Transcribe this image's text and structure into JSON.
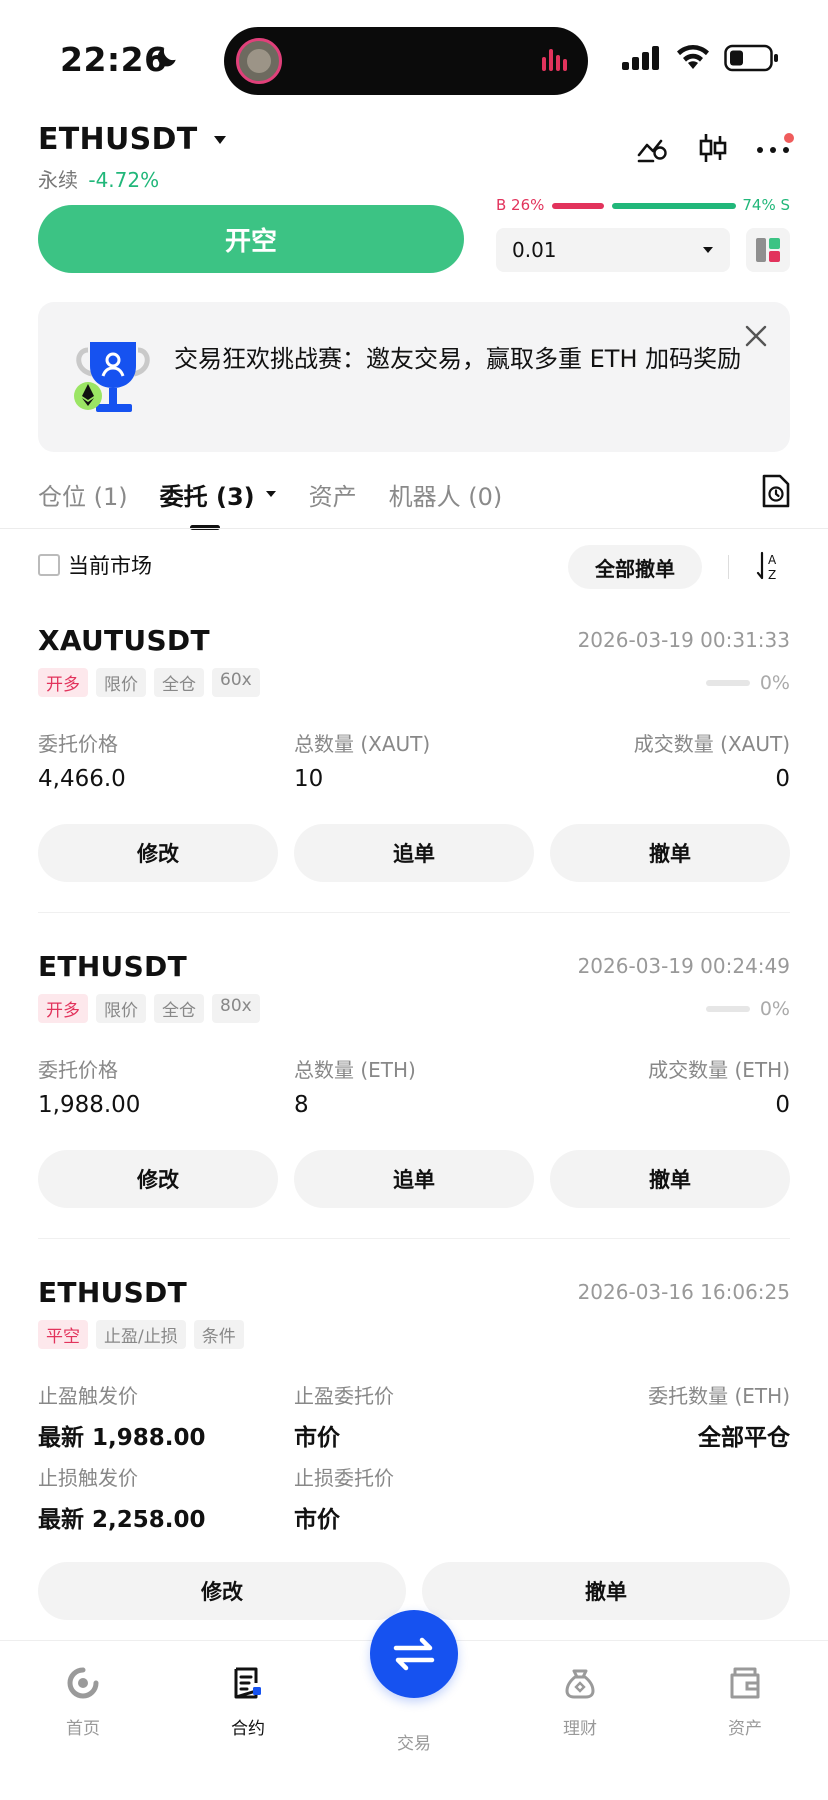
{
  "status": {
    "time": "22:26"
  },
  "header": {
    "pair": "ETHUSDT",
    "type": "永续",
    "change": "-4.72%",
    "open_short_label": "开空",
    "ratio_b": "B 26%",
    "ratio_s": "74% S",
    "qty_value": "0.01"
  },
  "banner": {
    "text": "交易狂欢挑战赛：邀友交易，赢取多重 ETH 加码奖励"
  },
  "tabs": [
    {
      "label": "仓位 (1)"
    },
    {
      "label": "委托 (3)"
    },
    {
      "label": "资产"
    },
    {
      "label": "机器人 (0)"
    }
  ],
  "filter": {
    "current_market": "当前市场",
    "cancel_all": "全部撤单"
  },
  "orders": [
    {
      "symbol": "XAUTUSDT",
      "time": "2026-03-19 00:31:33",
      "tags": [
        "开多",
        "限价",
        "全仓",
        "60x"
      ],
      "progress": "0%",
      "labels": [
        "委托价格",
        "总数量 (XAUT)",
        "成交数量 (XAUT)"
      ],
      "values": [
        "4,466.0",
        "10",
        "0"
      ],
      "actions": [
        "修改",
        "追单",
        "撤单"
      ]
    },
    {
      "symbol": "ETHUSDT",
      "time": "2026-03-19 00:24:49",
      "tags": [
        "开多",
        "限价",
        "全仓",
        "80x"
      ],
      "progress": "0%",
      "labels": [
        "委托价格",
        "总数量 (ETH)",
        "成交数量 (ETH)"
      ],
      "values": [
        "1,988.00",
        "8",
        "0"
      ],
      "actions": [
        "修改",
        "追单",
        "撤单"
      ]
    },
    {
      "symbol": "ETHUSDT",
      "time": "2026-03-16 16:06:25",
      "tags": [
        "平空",
        "止盈/止损",
        "条件"
      ],
      "labels": [
        "止盈触发价",
        "止盈委托价",
        "委托数量 (ETH)",
        "止损触发价",
        "止损委托价"
      ],
      "values": [
        "最新 1,988.00",
        "市价",
        "全部平仓",
        "最新 2,258.00",
        "市价"
      ],
      "actions": [
        "修改",
        "撤单"
      ]
    }
  ],
  "nav": [
    {
      "label": "首页"
    },
    {
      "label": "合约"
    },
    {
      "label": "交易"
    },
    {
      "label": "理财"
    },
    {
      "label": "资产"
    }
  ],
  "colors": {
    "green": "#3cc384",
    "red": "#e2335c",
    "blue": "#1652f0"
  }
}
